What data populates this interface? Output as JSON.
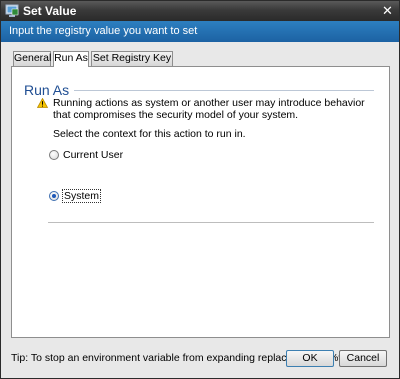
{
  "window": {
    "title": "Set Value",
    "close_glyph": "✕",
    "icon": "registry-app-icon"
  },
  "banner": {
    "text": "Input the registry value you want to set"
  },
  "tabs": [
    {
      "label": "General",
      "active": false
    },
    {
      "label": "Run As",
      "active": true
    },
    {
      "label": "Set Registry Key",
      "active": false
    }
  ],
  "section": {
    "title": "Run As",
    "warning_icon": "warning-icon",
    "warning_text": "Running actions as system or another user may introduce behavior that compromises the security model of your system.",
    "prompt": "Select the context for this action to run in."
  },
  "options": [
    {
      "label": "Current User",
      "selected": false
    },
    {
      "label": "System",
      "selected": true
    }
  ],
  "footer": {
    "tip": "Tip: To stop an environment variable from expanding replace % with %%.",
    "ok_label": "OK",
    "cancel_label": "Cancel"
  },
  "colors": {
    "title_bar": "#3a3a3a",
    "banner": "#1f6cb0",
    "section_title": "#1f4e93",
    "radio_selected": "#1f58b7"
  }
}
